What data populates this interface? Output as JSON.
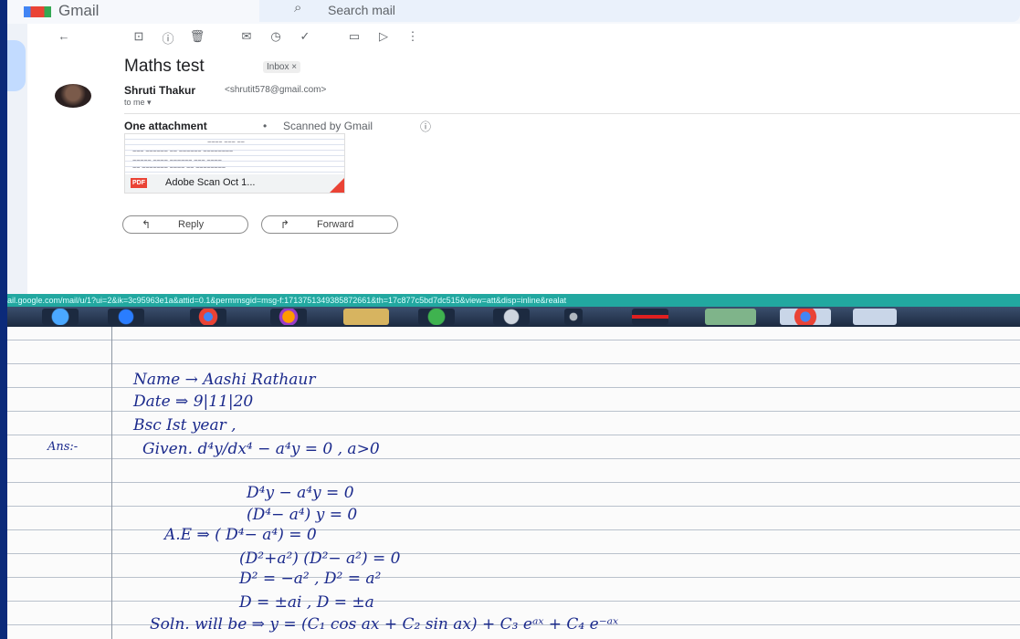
{
  "gmail": {
    "app_name": "Gmail",
    "search_placeholder": "Search mail",
    "subject": "Maths test",
    "label_tag": "Inbox ×",
    "sender_name": "Shruti Thakur",
    "sender_email": "<shrutit578@gmail.com>",
    "recipient": "to me ▾",
    "attachment_count": "One attachment",
    "separator": "•",
    "scan_status": "Scanned by Gmail",
    "info_icon": "ⓘ",
    "attachment_name": "Adobe Scan Oct 1...",
    "attachment_type": "PDF",
    "reply_label": "Reply",
    "forward_label": "Forward",
    "toolbar_icons": [
      "back-icon",
      "archive-icon",
      "report-spam-icon",
      "delete-icon",
      "mark-unread-icon",
      "snooze-icon",
      "add-task-icon",
      "move-to-icon",
      "labels-icon",
      "more-icon"
    ]
  },
  "status_url": "ail.google.com/mail/u/1?ui=2&ik=3c95963e1a&attid=0.1&permmsgid=msg-f:1713751349385872661&th=17c877c5bd7dc515&view=att&disp=inline&realat",
  "taskbar": {
    "apps": [
      "internet-explorer",
      "media-player",
      "chrome",
      "firefox",
      "file-explorer",
      "windows-media-center",
      "media-center",
      "chess",
      "acrobat",
      "excel",
      "chrome-profile",
      "word"
    ]
  },
  "notebook": {
    "lines": [
      "Name → Aashi Rathaur",
      "Date ⇒ 9|11|20",
      "Bsc Ist year ,",
      "Ans:-",
      "Given. d⁴y/dx⁴ − a⁴y = 0 , a>0",
      "D⁴y − a⁴y = 0",
      "(D⁴− a⁴) y = 0",
      "A.E ⇒ ( D⁴− a⁴) = 0",
      "(D²+a²) (D²− a²) = 0",
      "D² = −a² , D² = a²",
      "D = ±ai , D = ±a",
      "Soln. will be ⇒ y = (C₁ cos ax + C₂ sin ax) + C₃ eᵃˣ + C₄ e⁻ᵃˣ"
    ]
  }
}
